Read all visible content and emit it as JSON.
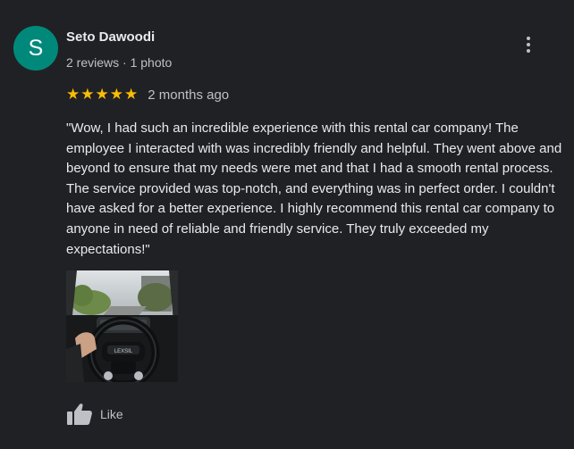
{
  "reviewer": {
    "avatar_letter": "S",
    "avatar_color": "#00897b",
    "name": "Seto Dawoodi",
    "meta": "2 reviews · 1 photo"
  },
  "menu": {
    "icon": "more-vert-icon"
  },
  "rating": {
    "stars": 5,
    "star_glyph": "★",
    "star_color": "#fbbc04",
    "date": "2 months ago"
  },
  "review_text": "\"Wow, I had such an incredible experience with this rental car company! The employee I interacted with was incredibly friendly and helpful. They went above and beyond to ensure that my needs were met and that I had a smooth rental process. The service provided was top-notch, and everything was in perfect order. I couldn't have asked for a better experience. I highly recommend this rental car company to anyone in need of reliable and friendly service. They truly exceeded my expectations!\"",
  "photo": {
    "steering_badge": "LEXSIL"
  },
  "actions": {
    "like_label": "Like",
    "like_icon": "thumbs-up-icon"
  },
  "colors": {
    "background": "#202124",
    "text_primary": "#e8eaed",
    "text_secondary": "#bdc1c6"
  }
}
